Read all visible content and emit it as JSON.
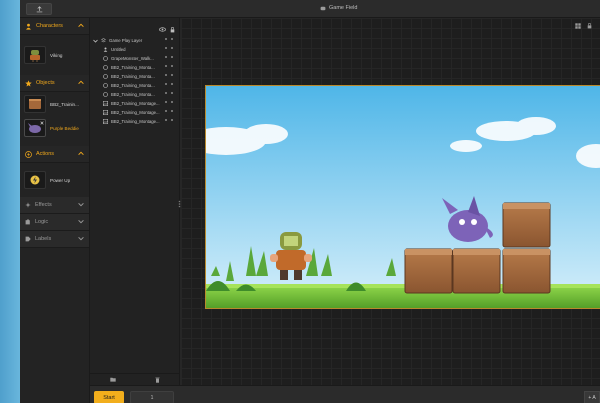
{
  "app": {
    "title": "Game Field",
    "colors": {
      "accent": "#f2ae1c",
      "background": "#262626"
    }
  },
  "sidebar": {
    "characters": {
      "label": "Characters",
      "items": [
        {
          "label": "Viking"
        }
      ]
    },
    "objects": {
      "label": "Objects",
      "items": [
        {
          "label": "BB2_Trainin..."
        },
        {
          "label": "Purple Beddie"
        }
      ]
    },
    "actions": {
      "label": "Actions",
      "items": [
        {
          "label": "Power Up"
        }
      ]
    },
    "effects": {
      "label": "Effects"
    },
    "logic": {
      "label": "Logic"
    },
    "labels": {
      "label": "Labels"
    }
  },
  "layers": {
    "root": "Game Play Layer",
    "rows": [
      {
        "label": "Untitled",
        "icon": "person-icon"
      },
      {
        "label": "GrapeMonster_Walk...",
        "icon": "circle-icon"
      },
      {
        "label": "BB2_Training_Monta...",
        "icon": "circle-icon"
      },
      {
        "label": "BB2_Training_Monta...",
        "icon": "circle-icon"
      },
      {
        "label": "BB2_Training_Monta...",
        "icon": "circle-icon"
      },
      {
        "label": "BB2_Training_Monta...",
        "icon": "circle-icon"
      },
      {
        "label": "BB2_Training_Montage...",
        "icon": "image-icon"
      },
      {
        "label": "BB2_Training_Montage...",
        "icon": "image-icon"
      },
      {
        "label": "BB2_Training_Montage...",
        "icon": "image-icon"
      }
    ]
  },
  "bottombar": {
    "start_label": "Start",
    "page_value": "1",
    "add_label": "+ A"
  }
}
